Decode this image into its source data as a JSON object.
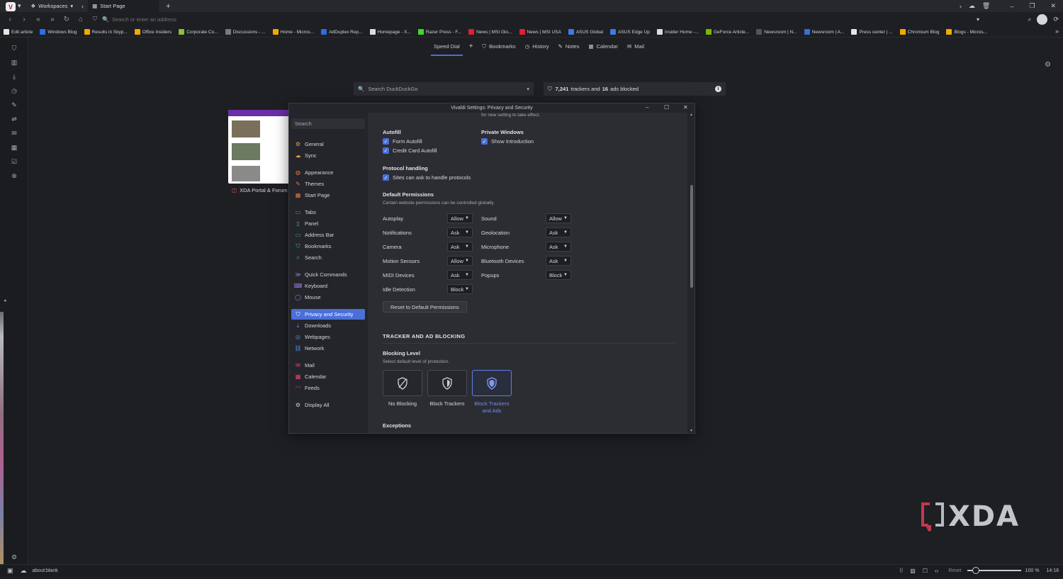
{
  "titlebar": {
    "workspaces_label": "Workspaces",
    "tab_title": "Start Page",
    "new_tab": "+"
  },
  "addressbar": {
    "placeholder": "Search or enter an address"
  },
  "bookmarks": [
    {
      "label": "Edit article",
      "color": "#e6e6e6"
    },
    {
      "label": "Windows Blog",
      "color": "#2a6ee8"
    },
    {
      "label": "Results in Skyp...",
      "color": "#f2a900"
    },
    {
      "label": "Office Insiders",
      "color": "#f2a900"
    },
    {
      "label": "Corporate Co...",
      "color": "#8bbf3c"
    },
    {
      "label": "Discussions - ...",
      "color": "#777a80"
    },
    {
      "label": "Home - Micros...",
      "color": "#f2a900"
    },
    {
      "label": "AdDuplex Rep...",
      "color": "#2a6ee8"
    },
    {
      "label": "Homepage - X...",
      "color": "#dcdcdc"
    },
    {
      "label": "Razer Press - F...",
      "color": "#44d62c"
    },
    {
      "label": "News | MSI Glo...",
      "color": "#e02030"
    },
    {
      "label": "News | MSI USA",
      "color": "#e02030"
    },
    {
      "label": "ASUS Global",
      "color": "#3a7ce8"
    },
    {
      "label": "ASUS Edge Up",
      "color": "#3a7ce8"
    },
    {
      "label": "Insider Home -...",
      "color": "#dcdcdc"
    },
    {
      "label": "GeForce Article...",
      "color": "#76b900"
    },
    {
      "label": "Newsroom | N...",
      "color": "#555"
    },
    {
      "label": "Newsroom | A...",
      "color": "#3a6fd8"
    },
    {
      "label": "Press center | ...",
      "color": "#e6e6e6"
    },
    {
      "label": "Chromium Blog",
      "color": "#f2a900"
    },
    {
      "label": "Blogs - Micros...",
      "color": "#f2a900"
    }
  ],
  "speeddial_nav": {
    "speed_dial": "Speed Dial",
    "add": "+",
    "bookmarks": "Bookmarks",
    "history": "History",
    "notes": "Notes",
    "calendar": "Calendar",
    "mail": "Mail"
  },
  "search": {
    "placeholder": "Search DuckDuckGo"
  },
  "tracker_stats": {
    "trackers": "7,241",
    "trackers_text": "trackers and",
    "ads": "16",
    "ads_text": "ads blocked"
  },
  "speeddial_tile": {
    "title": "XDA Portal & Forum"
  },
  "settings": {
    "window_title": "Vivaldi Settings: Privacy and Security",
    "search_placeholder": "Search",
    "sidebar": [
      {
        "label": "General",
        "icon": "gear-icon"
      },
      {
        "label": "Sync",
        "icon": "cloud-icon"
      },
      {
        "label": "Appearance",
        "icon": "palette-icon"
      },
      {
        "label": "Themes",
        "icon": "brush-icon"
      },
      {
        "label": "Start Page",
        "icon": "grid-icon"
      },
      {
        "label": "Tabs",
        "icon": "tabs-icon"
      },
      {
        "label": "Panel",
        "icon": "panel-icon"
      },
      {
        "label": "Address Bar",
        "icon": "address-bar-icon"
      },
      {
        "label": "Bookmarks",
        "icon": "bookmark-icon"
      },
      {
        "label": "Search",
        "icon": "search-icon"
      },
      {
        "label": "Quick Commands",
        "icon": "quick-commands-icon"
      },
      {
        "label": "Keyboard",
        "icon": "keyboard-icon"
      },
      {
        "label": "Mouse",
        "icon": "mouse-icon"
      },
      {
        "label": "Privacy and Security",
        "icon": "shield-icon"
      },
      {
        "label": "Downloads",
        "icon": "download-icon"
      },
      {
        "label": "Webpages",
        "icon": "globe-icon"
      },
      {
        "label": "Network",
        "icon": "network-icon"
      },
      {
        "label": "Mail",
        "icon": "mail-icon"
      },
      {
        "label": "Calendar",
        "icon": "calendar-icon"
      },
      {
        "label": "Feeds",
        "icon": "rss-icon"
      },
      {
        "label": "Display All",
        "icon": "gear-icon"
      }
    ],
    "top_note": "for new setting to take effect.",
    "autofill": {
      "heading": "Autofill",
      "form": "Form Autofill",
      "credit_card": "Credit Card Autofill"
    },
    "private_windows": {
      "heading": "Private Windows",
      "show_intro": "Show Introduction"
    },
    "protocol": {
      "heading": "Protocol handling",
      "sites_can_ask": "Sites can ask to handle protocols"
    },
    "default_permissions": {
      "heading": "Default Permissions",
      "subtitle": "Certain website permissions can be controlled globally.",
      "left": [
        {
          "label": "Autoplay",
          "value": "Allow"
        },
        {
          "label": "Notifications",
          "value": "Ask"
        },
        {
          "label": "Camera",
          "value": "Ask"
        },
        {
          "label": "Motion Sensors",
          "value": "Allow"
        },
        {
          "label": "MIDI Devices",
          "value": "Ask"
        },
        {
          "label": "Idle Detection",
          "value": "Block"
        }
      ],
      "right": [
        {
          "label": "Sound",
          "value": "Allow"
        },
        {
          "label": "Geolocation",
          "value": "Ask"
        },
        {
          "label": "Microphone",
          "value": "Ask"
        },
        {
          "label": "Bluetooth Devices",
          "value": "Ask"
        },
        {
          "label": "Popups",
          "value": "Block"
        }
      ],
      "reset_button": "Reset to Default Permissions"
    },
    "tracker": {
      "section_title": "TRACKER AND AD BLOCKING",
      "blocking_level": "Blocking Level",
      "blocking_sub": "Select default level of protection.",
      "options": [
        "No Blocking",
        "Block Trackers",
        "Block Trackers and Ads"
      ],
      "selected": "Block Trackers and Ads",
      "exceptions": "Exceptions"
    }
  },
  "statusbar": {
    "url": "about:blank",
    "reset": "Reset",
    "zoom": "100 %",
    "time": "14:18"
  },
  "watermark": "XDA",
  "colors": {
    "accent": "#4a6fd8",
    "background": "#1e1f23"
  }
}
